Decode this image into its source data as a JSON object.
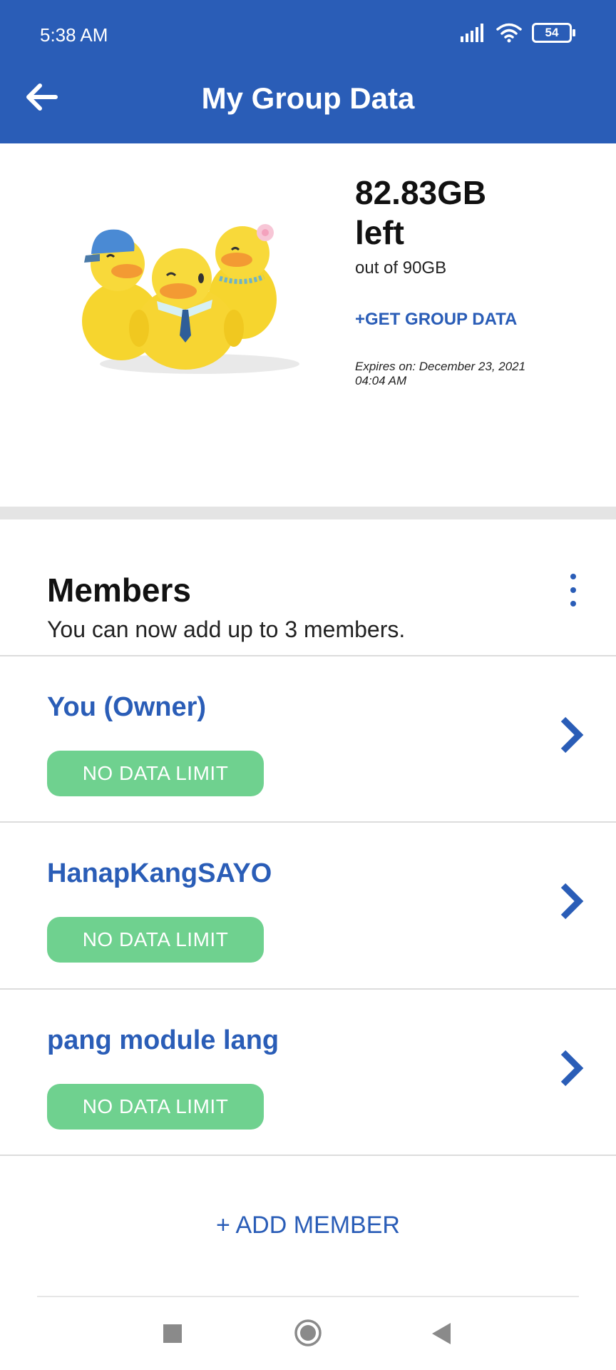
{
  "status_bar": {
    "time": "5:38 AM",
    "battery": "54"
  },
  "header": {
    "title": "My Group Data"
  },
  "usage": {
    "amount": "82.83GB",
    "left_label": "left",
    "total": "out of 90GB",
    "get_data_label": "+GET GROUP DATA",
    "expires_line1": "Expires on: December 23, 2021",
    "expires_line2": "04:04 AM"
  },
  "members": {
    "title": "Members",
    "subtitle": "You can now add up to 3 members.",
    "list": [
      {
        "name": "You (Owner)",
        "limit": "NO DATA LIMIT"
      },
      {
        "name": "HanapKangSAYO",
        "limit": "NO DATA LIMIT"
      },
      {
        "name": "pang module lang",
        "limit": "NO DATA LIMIT"
      }
    ],
    "add_label": "+ ADD MEMBER"
  },
  "colors": {
    "brand": "#2a5db7",
    "badge": "#6fd18f",
    "divider": "#e4e4e4"
  },
  "icons": [
    "back-arrow-icon",
    "signal-icon",
    "wifi-icon",
    "battery-icon",
    "more-vert-icon",
    "chevron-right-icon",
    "nav-recents-icon",
    "nav-home-icon",
    "nav-back-icon"
  ]
}
